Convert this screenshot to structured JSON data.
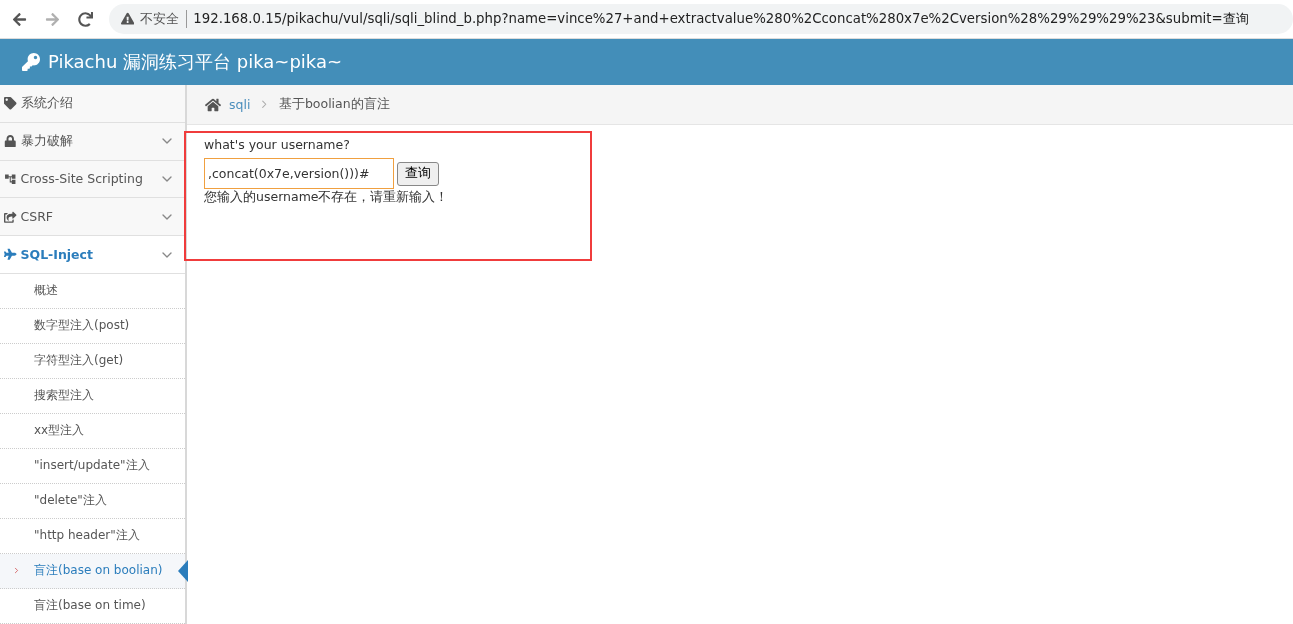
{
  "browser": {
    "security": "不安全",
    "url": "192.168.0.15/pikachu/vul/sqli/sqli_blind_b.php?name=vince%27+and+extractvalue%280%2Cconcat%280x7e%2Cversion%28%29%29%29%23&submit=查询"
  },
  "header": {
    "title": "Pikachu 漏洞练习平台 pika~pika~"
  },
  "sidebar": {
    "items": [
      {
        "kind": "tag",
        "label": "系统介绍",
        "expanded": false,
        "has_caret": false
      },
      {
        "kind": "lock",
        "label": "暴力破解",
        "expanded": false,
        "has_caret": true
      },
      {
        "kind": "tree",
        "label": "Cross-Site Scripting",
        "expanded": false,
        "has_caret": true
      },
      {
        "kind": "share",
        "label": "CSRF",
        "expanded": false,
        "has_caret": true
      },
      {
        "kind": "plane",
        "label": "SQL-Inject",
        "expanded": true,
        "has_caret": true,
        "children": [
          {
            "label": "概述",
            "selected": false
          },
          {
            "label": "数字型注入(post)",
            "selected": false
          },
          {
            "label": "字符型注入(get)",
            "selected": false
          },
          {
            "label": "搜索型注入",
            "selected": false
          },
          {
            "label": "xx型注入",
            "selected": false
          },
          {
            "label": "\"insert/update\"注入",
            "selected": false
          },
          {
            "label": "\"delete\"注入",
            "selected": false
          },
          {
            "label": "\"http header\"注入",
            "selected": false
          },
          {
            "label": "盲注(base on boolian)",
            "selected": true
          },
          {
            "label": "盲注(base on time)",
            "selected": false
          }
        ]
      }
    ]
  },
  "breadcrumb": {
    "link": "sqli",
    "current": "基于boolian的盲注"
  },
  "form": {
    "prompt": "what's your username?",
    "value": ",concat(0x7e,version()))#",
    "button": "查询",
    "message": "您输入的username不存在，请重新输入！"
  }
}
